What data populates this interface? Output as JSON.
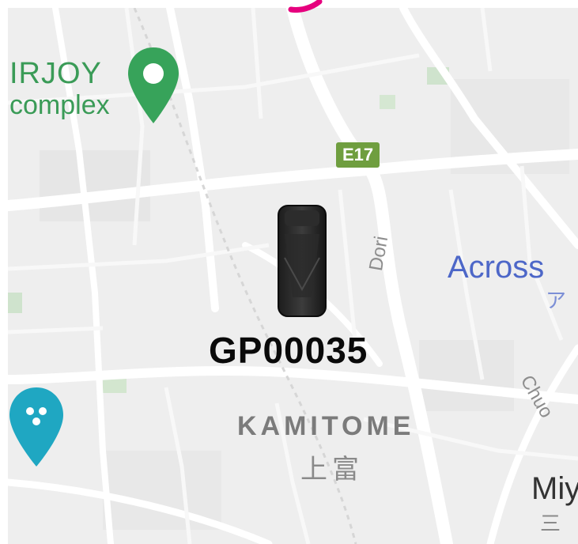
{
  "device": {
    "id": "GP00035",
    "icon": "gps-tracker-icon"
  },
  "pois": {
    "top_left_name": "IRJOY",
    "top_left_sub": "complex",
    "top_left_icon": "green-place-pin-icon",
    "bottom_left_icon": "teal-place-pin-icon"
  },
  "road": {
    "shield": "E17"
  },
  "places": {
    "right_blue": "Across",
    "right_blue_sub": "ア",
    "right_street": "Chuo",
    "bottom_right": "Miy",
    "bottom_right_sub": "三"
  },
  "street_label": "Dori",
  "area": {
    "name_en": "KAMITOME",
    "name_ja": "上富"
  },
  "colors": {
    "map_background": "#efefef",
    "road": "#ffffff",
    "poi_green": "#3a9b57",
    "poi_teal": "#1fa7c2",
    "highway_shield": "#6f9e3f",
    "route_accent": "#e6007e"
  }
}
